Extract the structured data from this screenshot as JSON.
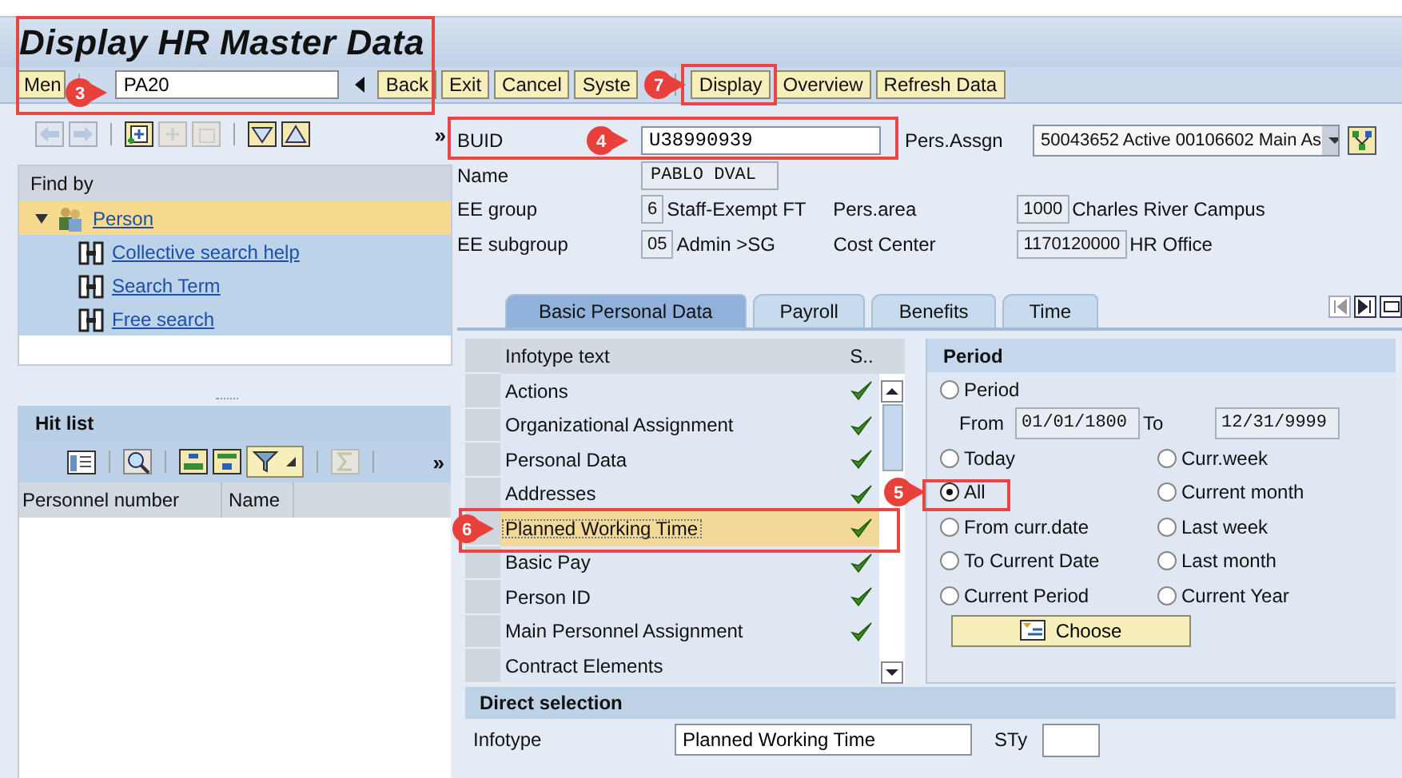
{
  "title": "Display HR Master Data",
  "toolbar": {
    "menu": "Men",
    "command": "PA20",
    "buttons": [
      "Back",
      "Exit",
      "Cancel",
      "Syste"
    ],
    "buttons_right": [
      "Display",
      "Overview",
      "Refresh Data"
    ]
  },
  "nav_more": "»",
  "find_by": {
    "title": "Find by",
    "items": [
      {
        "label": "Person",
        "expanded": true,
        "selected": true,
        "children": [
          {
            "label": "Collective search help",
            "selected": false
          },
          {
            "label": "Search Term",
            "selected": false
          },
          {
            "label": "Free search",
            "selected": false
          }
        ]
      }
    ]
  },
  "hit_list": {
    "title": "Hit list",
    "more": "»",
    "columns": [
      "Personnel number",
      "Name"
    ]
  },
  "header": {
    "buid_label": "BUID",
    "buid": "U38990939",
    "assignment_label": "Pers.Assgn",
    "assignment": "50043652 Active 00106602 Main As",
    "name_label": "Name",
    "name": "PABLO DVAL",
    "ee_group_label": "EE group",
    "ee_group_code": "6",
    "ee_group": "Staff-Exempt FT",
    "pers_area_label": "Pers.area",
    "pers_area_code": "1000",
    "pers_area": "Charles River Campus",
    "ee_subgroup_label": "EE subgroup",
    "ee_subgroup_code": "05",
    "ee_subgroup": "Admin >SG",
    "cost_center_label": "Cost Center",
    "cost_center_code": "1170120000",
    "cost_center": "HR Office"
  },
  "tabs": [
    {
      "label": "Basic Personal Data",
      "selected": true
    },
    {
      "label": "Payroll",
      "selected": false
    },
    {
      "label": "Benefits",
      "selected": false
    },
    {
      "label": "Time",
      "selected": false
    }
  ],
  "infotypes": {
    "columns": [
      "Infotype text",
      "S.."
    ],
    "rows": [
      {
        "text": "Actions",
        "checked": true,
        "selected": false
      },
      {
        "text": "Organizational Assignment",
        "checked": true,
        "selected": false
      },
      {
        "text": "Personal Data",
        "checked": true,
        "selected": false
      },
      {
        "text": "Addresses",
        "checked": true,
        "selected": false
      },
      {
        "text": "Planned Working Time",
        "checked": true,
        "selected": true
      },
      {
        "text": "Basic Pay",
        "checked": true,
        "selected": false
      },
      {
        "text": "Person ID",
        "checked": true,
        "selected": false
      },
      {
        "text": "Main Personnel Assignment",
        "checked": true,
        "selected": false
      },
      {
        "text": "Contract Elements",
        "checked": false,
        "selected": false
      }
    ]
  },
  "period": {
    "title": "Period",
    "period_option": {
      "label": "Period",
      "selected": false
    },
    "from_label": "From",
    "from": "01/01/1800",
    "to_label": "To",
    "to": "12/31/9999",
    "options": [
      {
        "label": "Today",
        "selected": false
      },
      {
        "label": "Curr.week",
        "selected": false
      },
      {
        "label": "All",
        "selected": true
      },
      {
        "label": "Current month",
        "selected": false
      },
      {
        "label": "From curr.date",
        "selected": false
      },
      {
        "label": "Last week",
        "selected": false
      },
      {
        "label": "To Current Date",
        "selected": false
      },
      {
        "label": "Last month",
        "selected": false
      },
      {
        "label": "Current Period",
        "selected": false
      },
      {
        "label": "Current Year",
        "selected": false
      }
    ],
    "choose": "Choose"
  },
  "direct_selection": {
    "title": "Direct selection",
    "infotype_label": "Infotype",
    "infotype": "Planned Working Time",
    "subtype_label": "STy"
  },
  "callouts": [
    {
      "number": "3"
    },
    {
      "number": "7"
    },
    {
      "number": "4"
    },
    {
      "number": "5"
    },
    {
      "number": "6"
    }
  ]
}
